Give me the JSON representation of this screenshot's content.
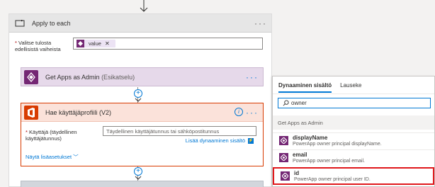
{
  "apply_each": {
    "title": "Apply to each",
    "select_label": "Valitse tulosta edellisistä vaiheista",
    "token_value": "value"
  },
  "get_apps": {
    "title": "Get Apps as Admin",
    "suffix": "(Esikatselu)"
  },
  "profile": {
    "title": "Hae käyttäjäprofiili (V2)",
    "user_label": "Käyttäjä (täydellinen käyttäjätunnus)",
    "user_placeholder": "Täydellinen käyttäjätunnus tai sähköpostitunnus",
    "add_dynamic": "Lisää dynaaminen sisältö",
    "show_advanced": "Näytä lisäasetukset"
  },
  "panel": {
    "tabs": [
      "Dynaaminen sisältö",
      "Lauseke"
    ],
    "search_value": "owner",
    "section": "Get Apps as Admin",
    "items": [
      {
        "name": "displayName",
        "desc": "PowerApp owner principal displayName."
      },
      {
        "name": "email",
        "desc": "PowerApp owner principal email."
      },
      {
        "name": "id",
        "desc": "PowerApp owner principal user ID."
      }
    ]
  },
  "colors": {
    "accent": "#0078d4",
    "powerapps": "#742774",
    "office": "#d83b01",
    "highlight": "#e0181b"
  }
}
